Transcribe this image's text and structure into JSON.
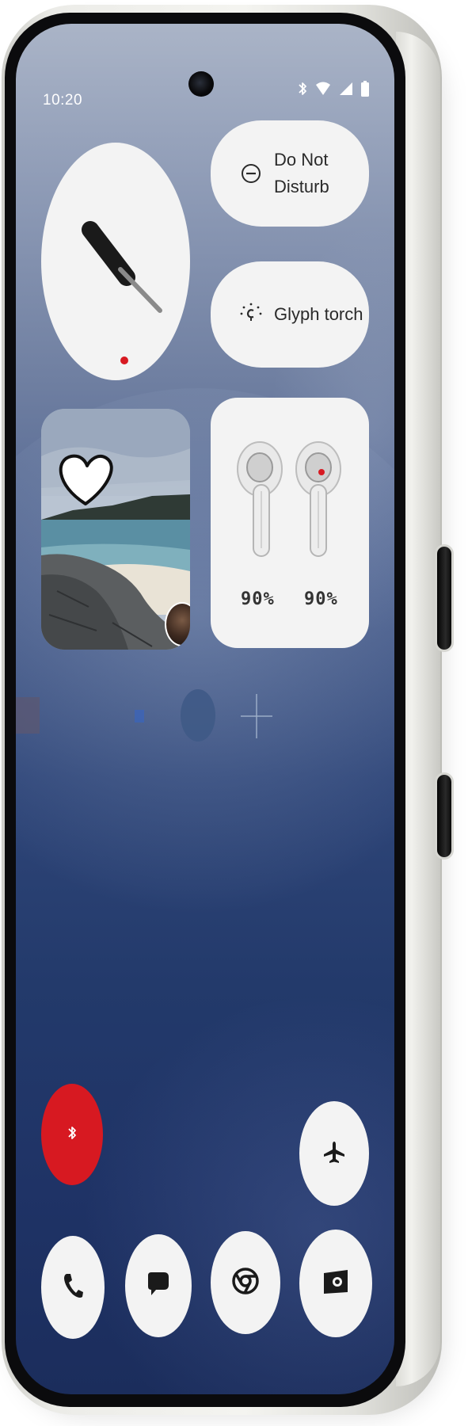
{
  "status_bar": {
    "time": "10:20",
    "icons": [
      "bluetooth-icon",
      "wifi-icon",
      "cellular-signal-icon",
      "battery-icon"
    ]
  },
  "widgets": {
    "clock": {
      "type": "analog-clock",
      "accent_color": "#d71921"
    },
    "do_not_disturb": {
      "label": "Do Not\nDisturb",
      "icon": "do-not-disturb-icon"
    },
    "glyph_torch": {
      "label": "Glyph torch",
      "icon": "glyph-torch-icon"
    },
    "photo": {
      "icon": "heart-icon",
      "has_avatar": true
    },
    "earbuds": {
      "left_battery": "90%",
      "right_battery": "90%"
    }
  },
  "quick_toggles": {
    "bluetooth": {
      "icon": "bluetooth-icon",
      "active": true,
      "color": "#d71921"
    },
    "airplane": {
      "icon": "airplane-icon",
      "active": false
    }
  },
  "dock": [
    {
      "name": "phone",
      "icon": "phone-icon"
    },
    {
      "name": "messages",
      "icon": "messages-icon"
    },
    {
      "name": "chrome",
      "icon": "chrome-icon"
    },
    {
      "name": "camera",
      "icon": "camera-icon"
    }
  ],
  "colors": {
    "accent": "#d71921",
    "widget_bg": "#f3f3f3",
    "wallpaper_top": "#aab4c7",
    "wallpaper_bottom": "#1b2d5c"
  }
}
